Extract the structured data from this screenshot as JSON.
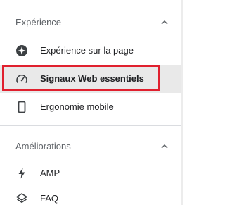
{
  "sections": [
    {
      "title": "Expérience",
      "chevron_icon": "chevron-up-icon",
      "items": [
        {
          "label": "Expérience sur la page",
          "icon": "page-experience-icon",
          "active": false
        },
        {
          "label": "Signaux Web essentiels",
          "icon": "speedometer-icon",
          "active": true
        },
        {
          "label": "Ergonomie mobile",
          "icon": "smartphone-icon",
          "active": false
        }
      ]
    },
    {
      "title": "Améliorations",
      "chevron_icon": "chevron-up-icon",
      "items": [
        {
          "label": "AMP",
          "icon": "lightning-bolt-icon",
          "active": false
        },
        {
          "label": "FAQ",
          "icon": "layers-icon",
          "active": false
        }
      ]
    }
  ],
  "colors": {
    "highlight": "#e0202e",
    "active_background": "#e9e9e9",
    "section_title": "#5f6368",
    "item_text": "#202124",
    "icon": "#3c4043"
  }
}
